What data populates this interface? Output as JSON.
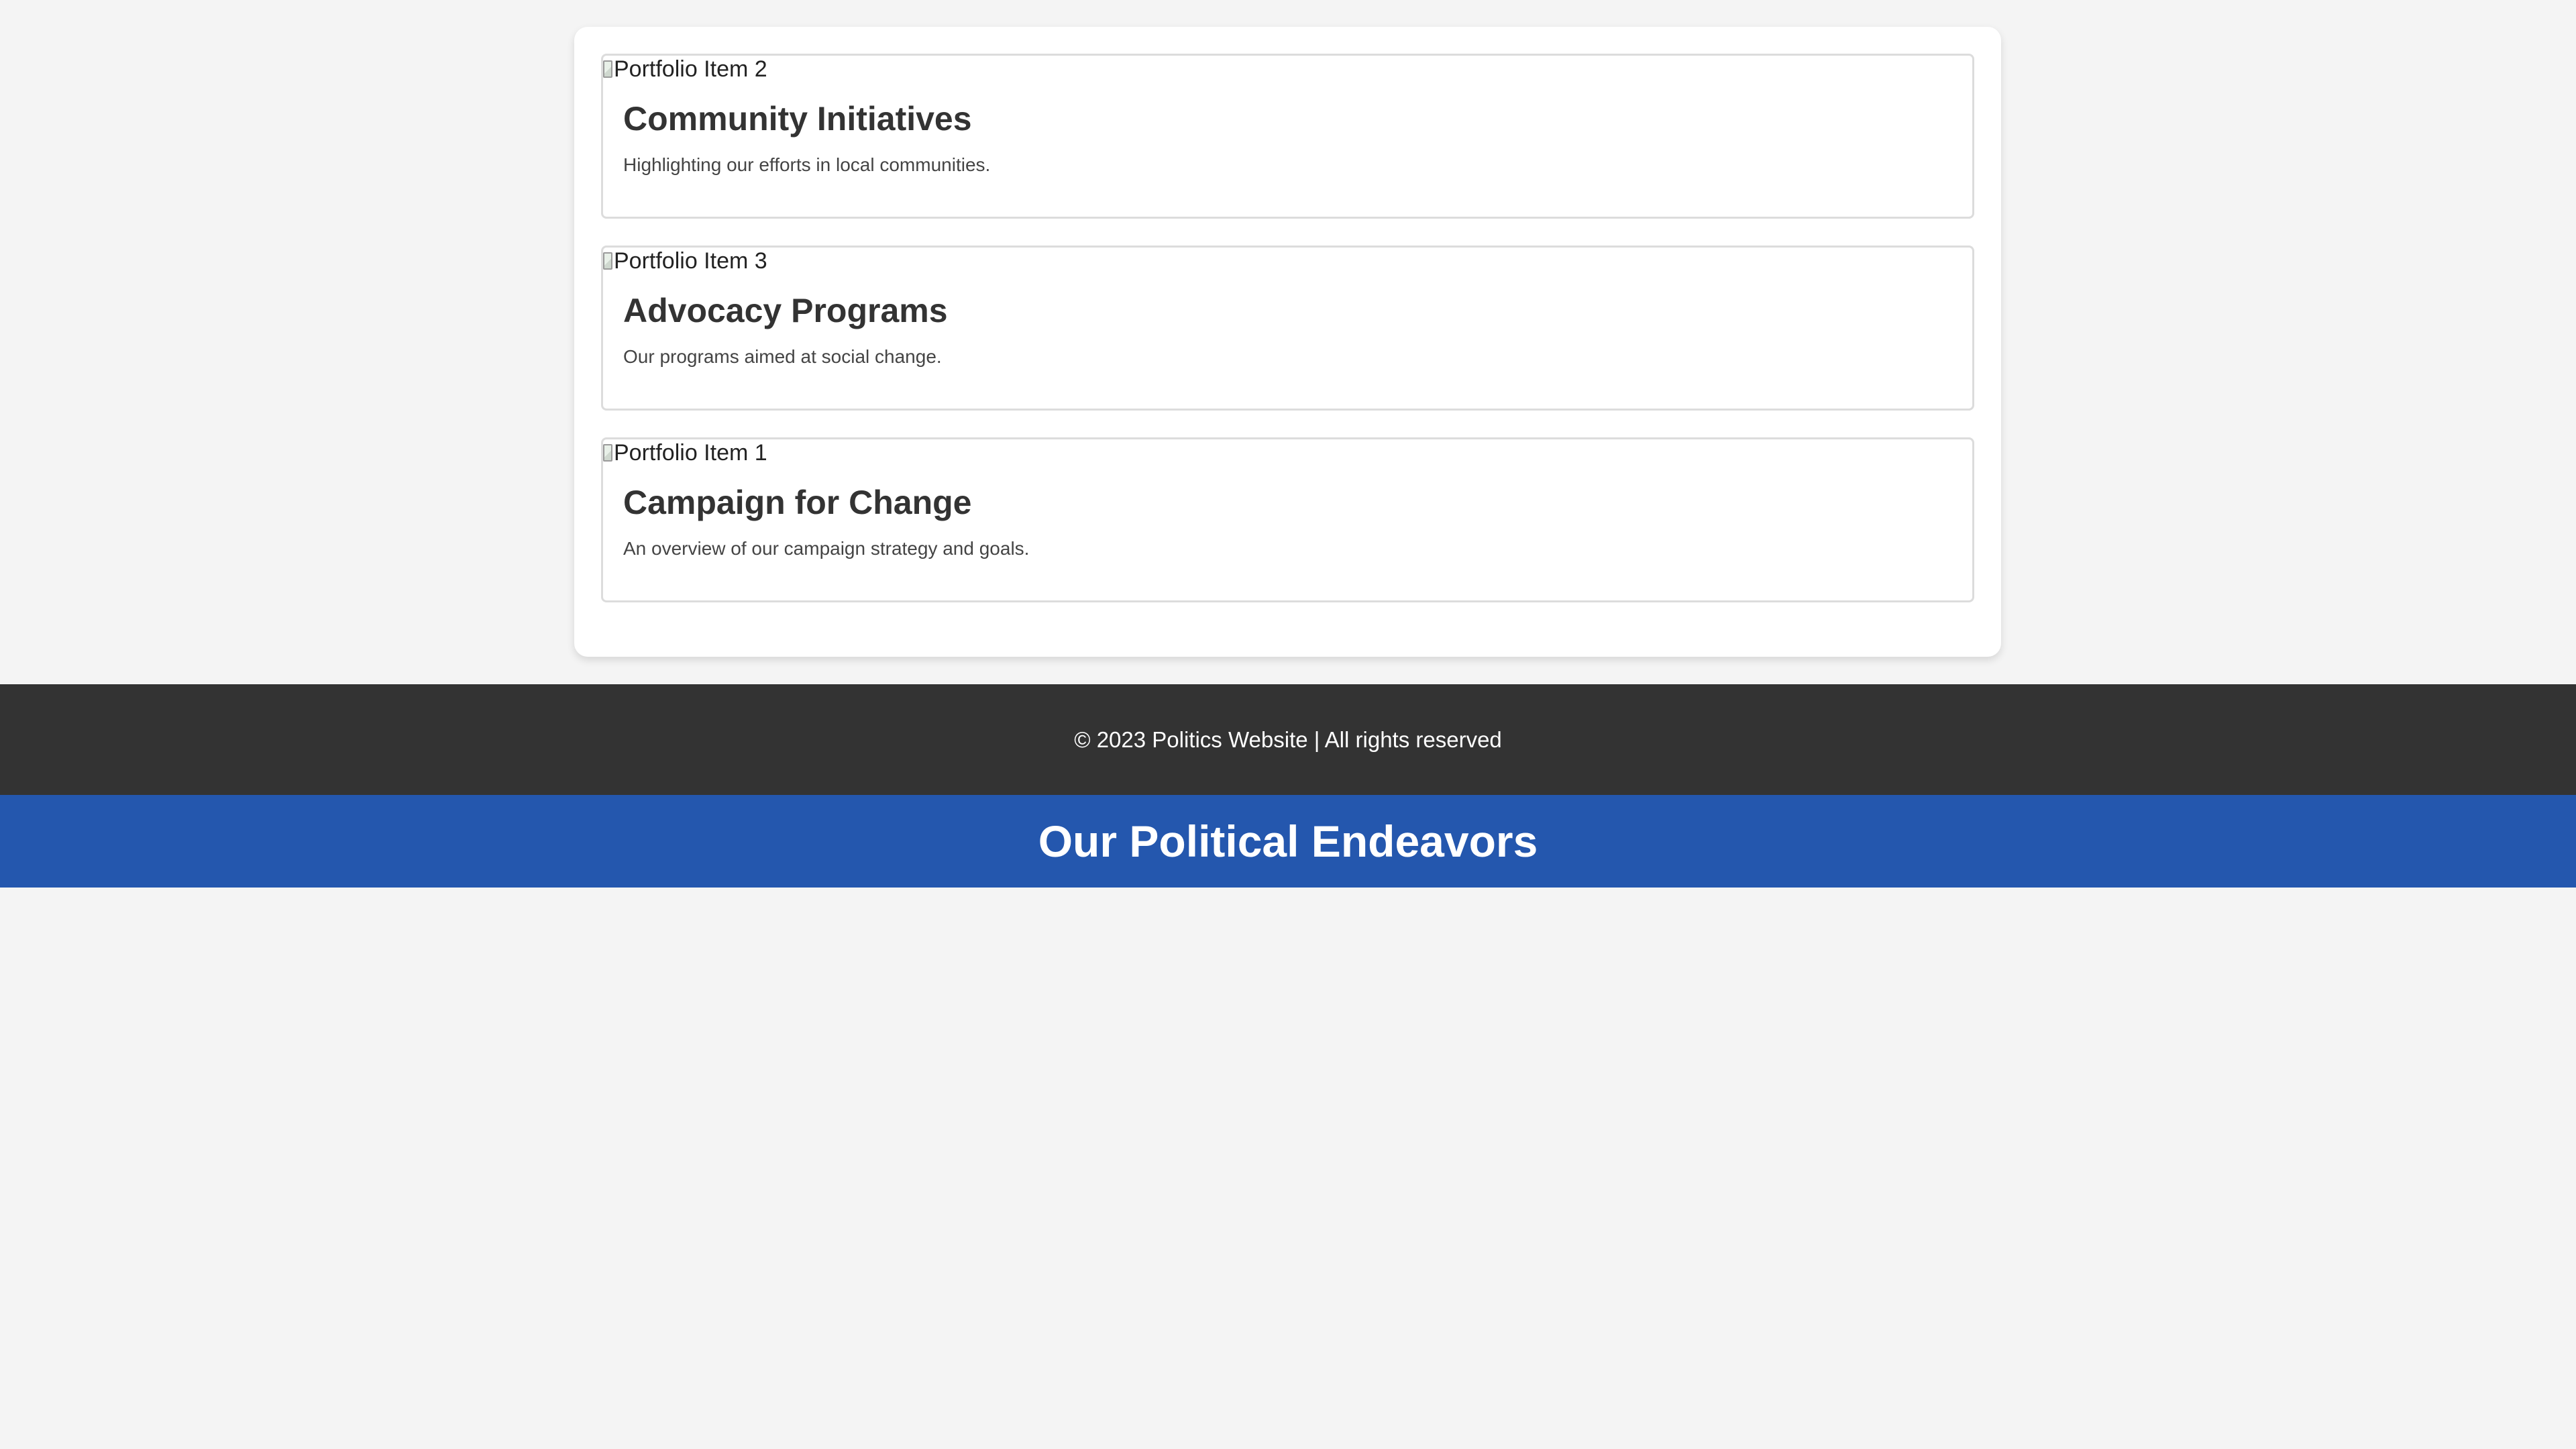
{
  "portfolio": {
    "items": [
      {
        "image_alt": "Portfolio Item 2",
        "title": "Community Initiatives",
        "description": "Highlighting our efforts in local communities."
      },
      {
        "image_alt": "Portfolio Item 3",
        "title": "Advocacy Programs",
        "description": "Our programs aimed at social change."
      },
      {
        "image_alt": "Portfolio Item 1",
        "title": "Campaign for Change",
        "description": "An overview of our campaign strategy and goals."
      }
    ]
  },
  "footer": {
    "text": "© 2023 Politics Website | All rights reserved"
  },
  "banner": {
    "title": "Our Political Endeavors"
  },
  "colors": {
    "page_background": "#f4f4f4",
    "footer_background": "#333333",
    "banner_background": "#2457ae"
  },
  "icons": {
    "broken_image": "broken-image-icon"
  }
}
